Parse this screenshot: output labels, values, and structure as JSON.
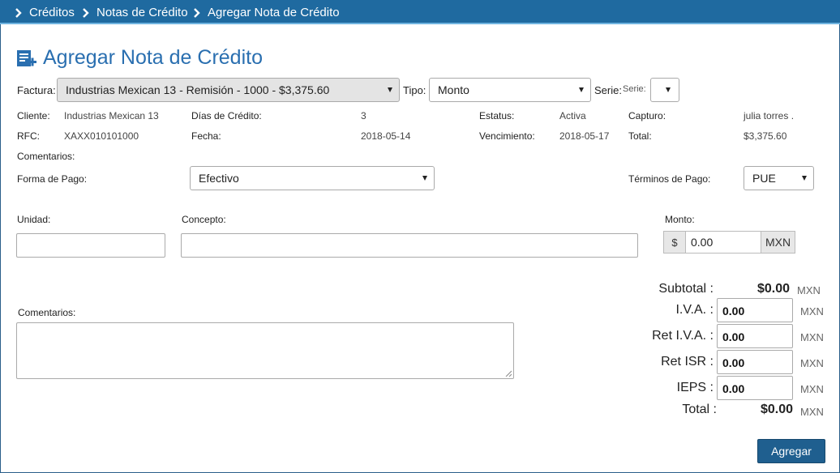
{
  "breadcrumb": [
    "Créditos",
    "Notas de Crédito",
    "Agregar Nota de Crédito"
  ],
  "page": {
    "title": "Agregar Nota de Crédito"
  },
  "form": {
    "factura_label": "Factura:",
    "factura_value": "Industrias Mexican 13 - Remisión - 1000 - $3,375.60",
    "tipo_label": "Tipo:",
    "tipo_value": "Monto",
    "serie_label": "Serie:",
    "serie_small": "Serie:"
  },
  "info": {
    "cliente_label": "Cliente:",
    "cliente": "Industrias Mexican 13",
    "rfc_label": "RFC:",
    "rfc": "XAXX010101000",
    "dias_label": "Días de Crédito:",
    "dias": "3",
    "fecha_label": "Fecha:",
    "fecha": "2018-05-14",
    "estatus_label": "Estatus:",
    "estatus": "Activa",
    "venc_label": "Vencimiento:",
    "vencimiento": "2018-05-17",
    "capturo_label": "Capturo:",
    "capturo": "julia torres .",
    "total_label": "Total:",
    "total": "$3,375.60",
    "comentarios_label": "Comentarios:"
  },
  "pago": {
    "forma_label": "Forma de Pago:",
    "forma_value": "Efectivo",
    "terminos_label": "Términos de Pago:",
    "terminos_value": "PUE"
  },
  "concepto": {
    "unidad_label": "Unidad:",
    "concepto_label": "Concepto:",
    "monto_label": "Monto:",
    "currency_symbol": "$",
    "monto_value": "0.00",
    "currency": "MXN"
  },
  "comentarios2_label": "Comentarios:",
  "totals": {
    "subtotal_label": "Subtotal :",
    "subtotal": "$0.00",
    "iva_label": "I.V.A. :",
    "iva": "0.00",
    "ret_iva_label": "Ret I.V.A. :",
    "ret_iva": "0.00",
    "ret_isr_label": "Ret ISR :",
    "ret_isr": "0.00",
    "ieps_label": "IEPS :",
    "ieps": "0.00",
    "total_label": "Total :",
    "total": "$0.00",
    "currency": "MXN"
  },
  "actions": {
    "submit": "Agregar"
  },
  "colors": {
    "accent": "#1f6aa0",
    "title": "#2a6fb0",
    "button": "#1f5f8f"
  }
}
